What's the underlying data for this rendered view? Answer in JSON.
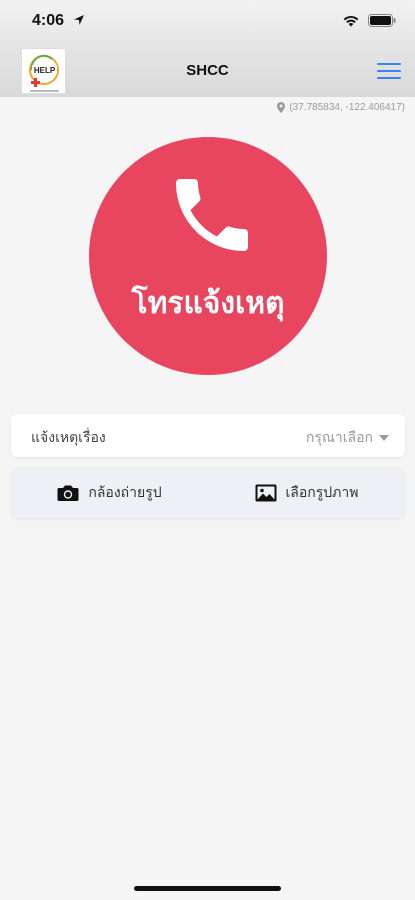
{
  "status_bar": {
    "time": "4:06"
  },
  "nav": {
    "title": "SHCC",
    "logo_text": "HELP"
  },
  "location": {
    "coordinates": "(37.785834, -122.406417)"
  },
  "call_button": {
    "label": "โทรแจ้งเหตุ",
    "color": "#e8465f",
    "icon": "phone-icon"
  },
  "report_topic": {
    "label": "แจ้งเหตุเรื่อง",
    "placeholder": "กรุณาเลือก"
  },
  "media": {
    "camera_label": "กล้องถ่ายรูป",
    "gallery_label": "เลือกรูปภาพ"
  },
  "colors": {
    "accent": "#3b82f6",
    "call_red": "#e8465f"
  }
}
